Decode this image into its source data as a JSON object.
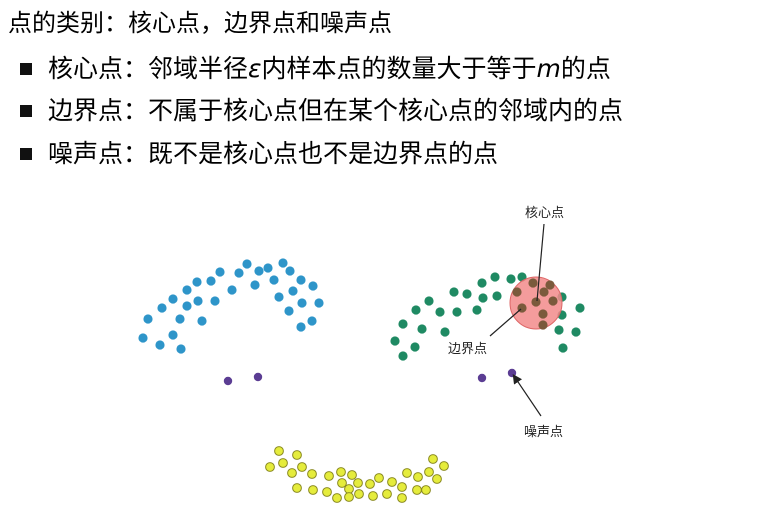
{
  "title": "点的类别：核心点，边界点和噪声点",
  "bullets": [
    {
      "pre": "核心点：邻域半径",
      "em": "ε",
      "mid": "内样本点的数量大于等于",
      "em2": "m",
      "post": "的点"
    },
    {
      "pre": "边界点：不属于核心点但在某个核心点的邻域内的点"
    },
    {
      "pre": "噪声点：既不是核心点也不是边界点的点"
    }
  ],
  "figure": {
    "labels": {
      "core": "核心点",
      "border": "边界点",
      "noise": "噪声点"
    },
    "colors": {
      "cluster1": "#2e95c9",
      "cluster2": "#1f8a63",
      "cluster3": "#e5ec3c",
      "noise": "#5b3d93",
      "core_region": "#f28b8b",
      "core_points": "#7a5a3c"
    }
  }
}
